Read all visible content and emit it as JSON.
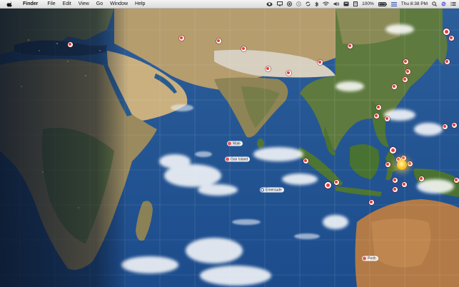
{
  "menubar": {
    "app_name": "Finder",
    "menus": [
      "File",
      "Edit",
      "View",
      "Go",
      "Window",
      "Help"
    ],
    "battery": "100%",
    "clock": "Thu 8:38 PM"
  },
  "map": {
    "places": [
      {
        "name": "Male",
        "type": "city"
      },
      {
        "name": "Gan Island",
        "type": "city"
      },
      {
        "name": "Emersude",
        "type": "current-location"
      },
      {
        "name": "Perth",
        "type": "city"
      }
    ],
    "sun_visible": true
  },
  "colors": {
    "ocean": "#1f4f8c",
    "quake_marker": "#e43c3c",
    "night_shade": "#0b1526",
    "sun": "#ffc21a"
  }
}
